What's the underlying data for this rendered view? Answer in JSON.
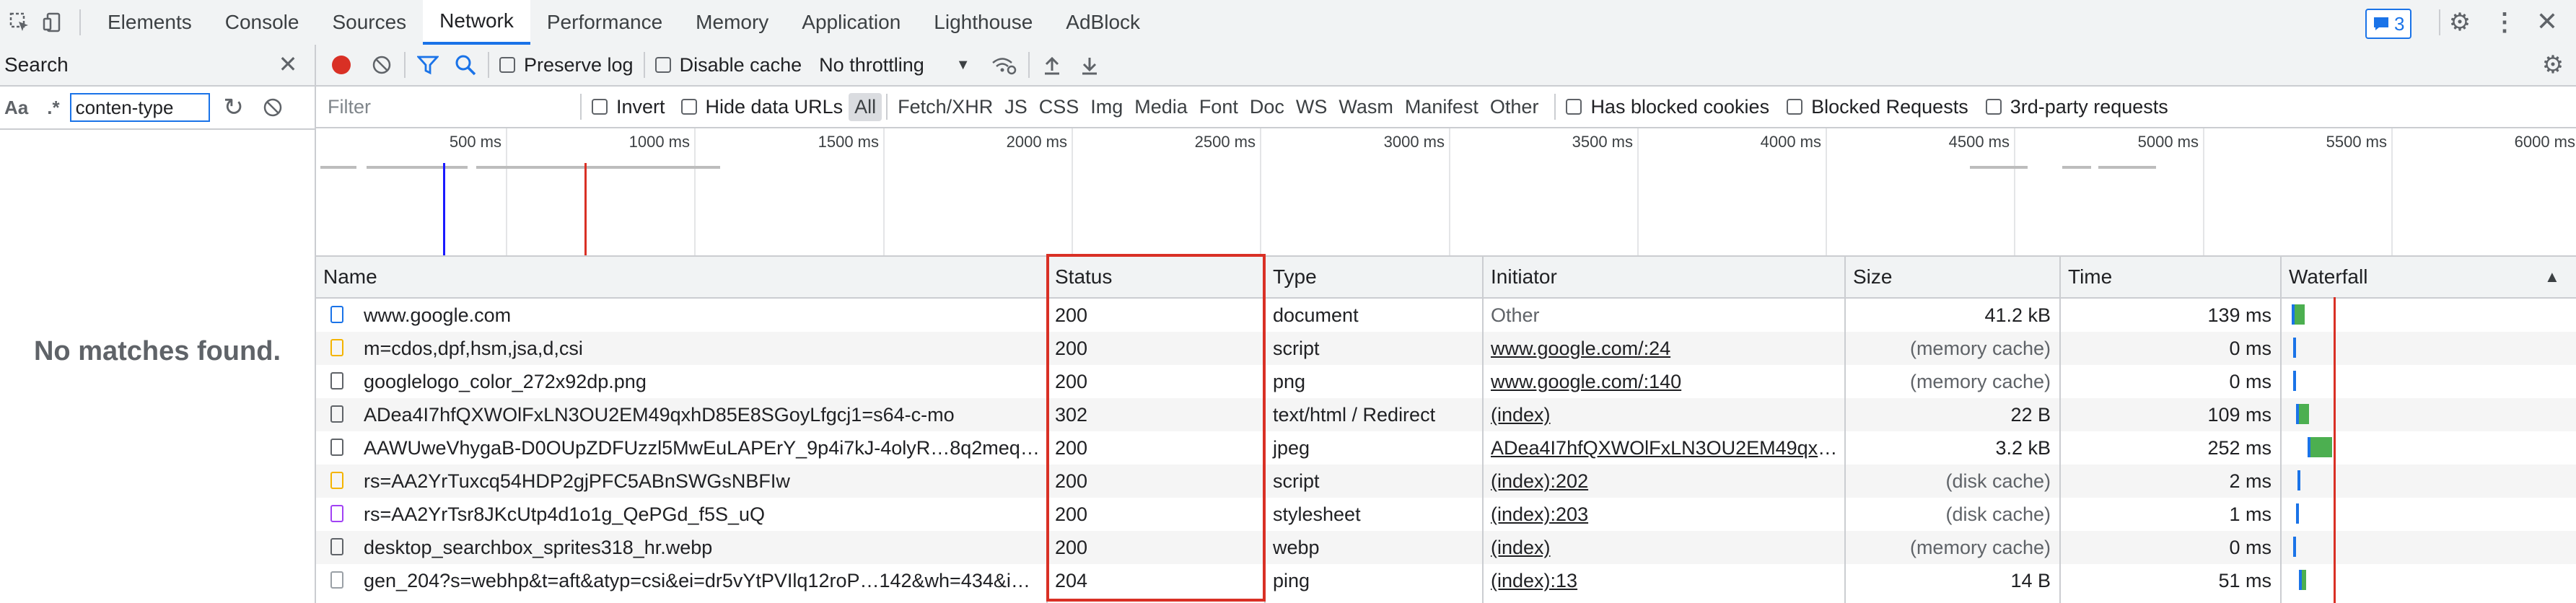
{
  "devtools": {
    "tabs": [
      "Elements",
      "Console",
      "Sources",
      "Network",
      "Performance",
      "Memory",
      "Application",
      "Lighthouse",
      "AdBlock"
    ],
    "active_tab": "Network",
    "issues_count": "3"
  },
  "search": {
    "title": "Search",
    "aa": "Aa",
    "regex": ".*",
    "query": "conten-type",
    "no_matches": "No matches found."
  },
  "network": {
    "preserve_log": "Preserve log",
    "disable_cache": "Disable cache",
    "throttling": "No throttling",
    "filter_placeholder": "Filter",
    "invert": "Invert",
    "hide_data_urls": "Hide data URLs",
    "type_filters": [
      "All",
      "Fetch/XHR",
      "JS",
      "CSS",
      "Img",
      "Media",
      "Font",
      "Doc",
      "WS",
      "Wasm",
      "Manifest",
      "Other"
    ],
    "has_blocked_cookies": "Has blocked cookies",
    "blocked_requests": "Blocked Requests",
    "third_party": "3rd-party requests",
    "overview_ticks": [
      "500 ms",
      "1000 ms",
      "1500 ms",
      "2000 ms",
      "2500 ms",
      "3000 ms",
      "3500 ms",
      "4000 ms",
      "4500 ms",
      "5000 ms",
      "5500 ms",
      "6000 ms"
    ],
    "columns": {
      "name": "Name",
      "status": "Status",
      "type": "Type",
      "initiator": "Initiator",
      "size": "Size",
      "time": "Time",
      "waterfall": "Waterfall"
    },
    "rows": [
      {
        "name": "www.google.com",
        "status": "200",
        "type": "document",
        "initiator": "Other",
        "size": "41.2 kB",
        "time": "139 ms",
        "icon": "document-icon"
      },
      {
        "name": "m=cdos,dpf,hsm,jsa,d,csi",
        "status": "200",
        "type": "script",
        "initiator": "www.google.com/:24",
        "size": "(memory cache)",
        "time": "0 ms",
        "icon": "script-icon"
      },
      {
        "name": "googlelogo_color_272x92dp.png",
        "status": "200",
        "type": "png",
        "initiator": "www.google.com/:140",
        "size": "(memory cache)",
        "time": "0 ms",
        "icon": "image-icon"
      },
      {
        "name": "ADea4I7hfQXWOlFxLN3OU2EM49qxhD85E8SGoyLfgcj1=s64-c-mo",
        "status": "302",
        "type": "text/html / Redirect",
        "initiator": "(index)",
        "size": "22 B",
        "time": "109 ms",
        "icon": "image-icon"
      },
      {
        "name": "AAWUweVhygaB-D0OUpZDFUzzl5MwEuLAPErY_9p4i7kJ-4olyR…8q2meqD…",
        "status": "200",
        "type": "jpeg",
        "initiator": "ADea4I7hfQXWOlFxLN3OU2EM49qxh…",
        "size": "3.2 kB",
        "time": "252 ms",
        "icon": "image-icon"
      },
      {
        "name": "rs=AA2YrTuxcq54HDP2gjPFC5ABnSWGsNBFIw",
        "status": "200",
        "type": "script",
        "initiator": "(index):202",
        "size": "(disk cache)",
        "time": "2 ms",
        "icon": "script-icon"
      },
      {
        "name": "rs=AA2YrTsr8JKcUtp4d1o1g_QePGd_f5S_uQ",
        "status": "200",
        "type": "stylesheet",
        "initiator": "(index):203",
        "size": "(disk cache)",
        "time": "1 ms",
        "icon": "stylesheet-icon"
      },
      {
        "name": "desktop_searchbox_sprites318_hr.webp",
        "status": "200",
        "type": "webp",
        "initiator": "(index)",
        "size": "(memory cache)",
        "time": "0 ms",
        "icon": "image-icon"
      },
      {
        "name": "gen_204?s=webhp&t=aft&atyp=csi&ei=dr5vYtPVIlq12roP…142&wh=434&imn…",
        "status": "204",
        "type": "ping",
        "initiator": "(index):13",
        "size": "14 B",
        "time": "51 ms",
        "icon": "file-icon"
      }
    ]
  }
}
